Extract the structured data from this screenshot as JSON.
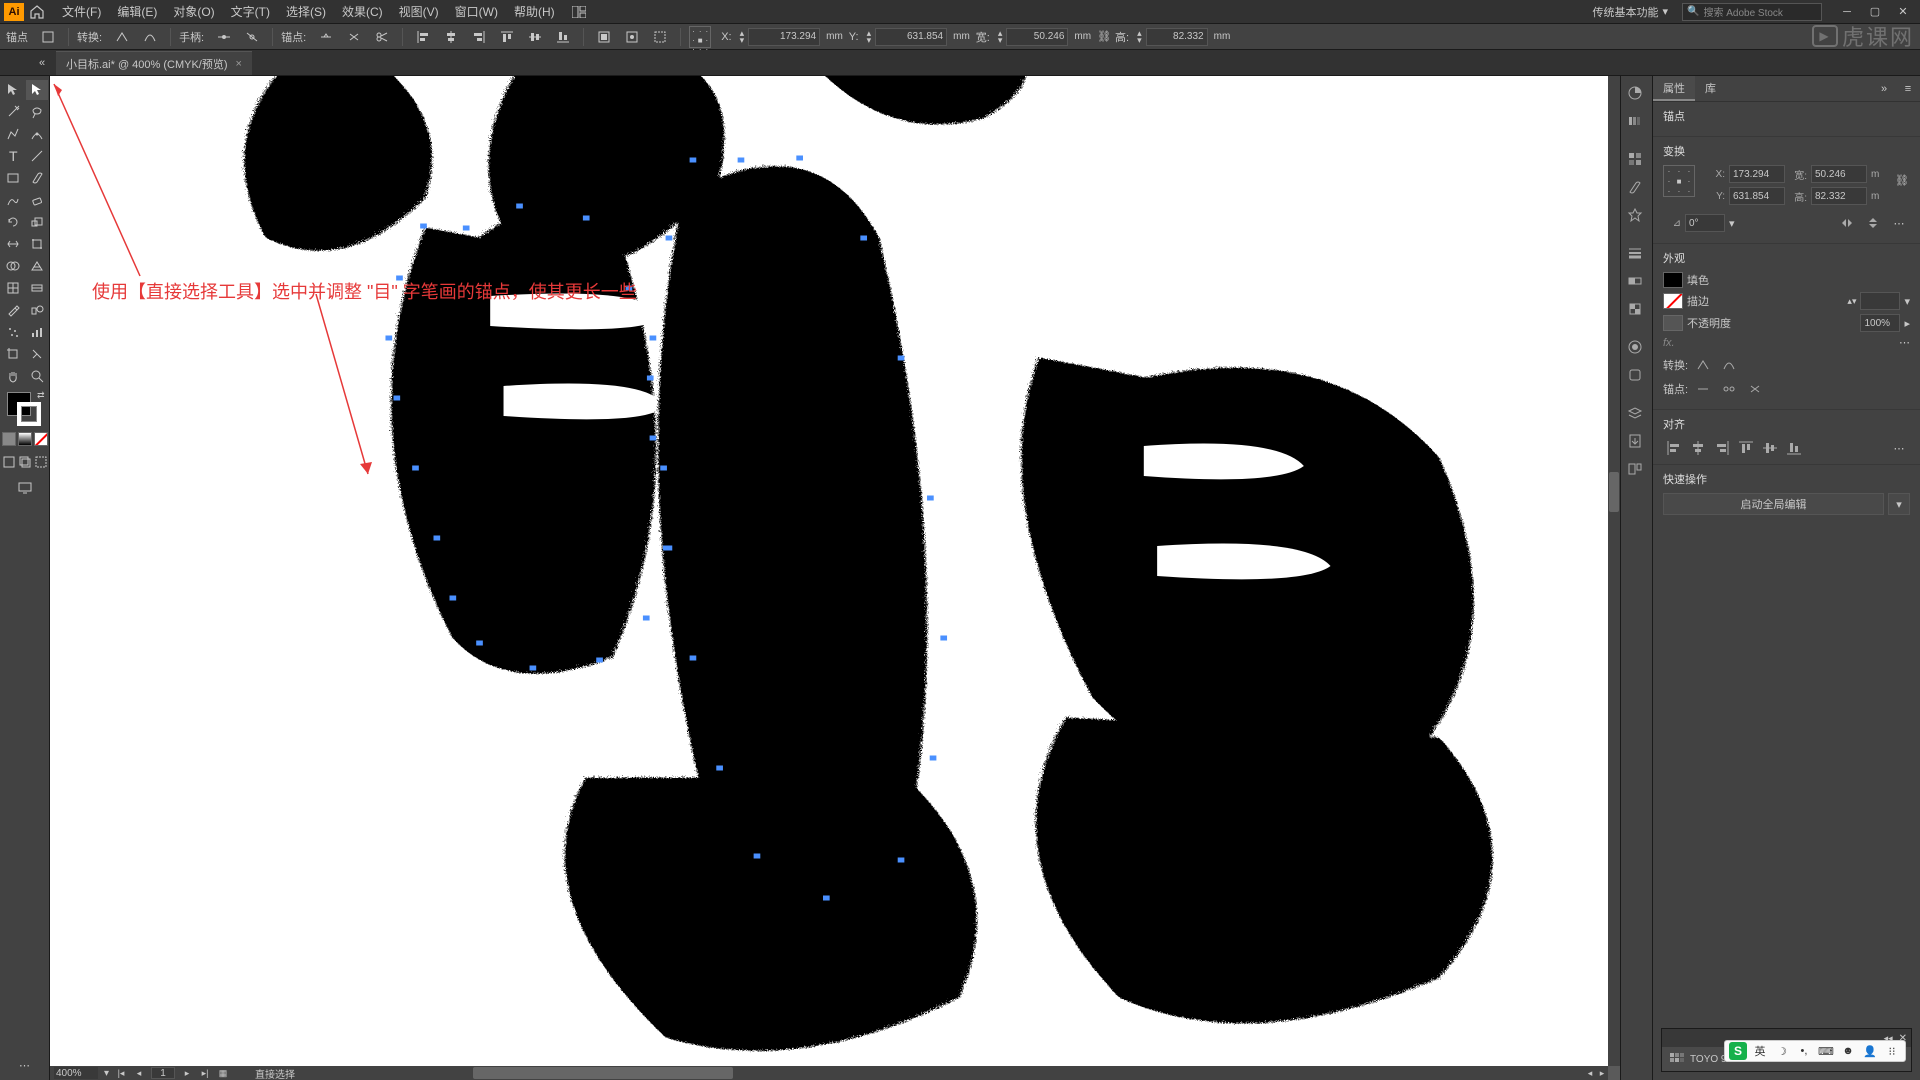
{
  "app": {
    "logo": "Ai"
  },
  "menu": {
    "file": "文件(F)",
    "edit": "编辑(E)",
    "object": "对象(O)",
    "type": "文字(T)",
    "select": "选择(S)",
    "effect": "效果(C)",
    "view": "视图(V)",
    "window": "窗口(W)",
    "help": "帮助(H)"
  },
  "workspace": {
    "label": "传统基本功能",
    "search_placeholder": "搜索 Adobe Stock"
  },
  "control": {
    "anchor_label": "锚点",
    "convert_label": "转换:",
    "handles_label": "手柄:",
    "anchors_label": "锚点:",
    "x_label": "X:",
    "x_val": "173.294",
    "x_unit": "mm",
    "y_label": "Y:",
    "y_val": "631.854",
    "y_unit": "mm",
    "w_label": "宽:",
    "w_val": "50.246",
    "w_unit": "mm",
    "h_label": "高:",
    "h_val": "82.332",
    "h_unit": "mm"
  },
  "tab": {
    "title": "小目标.ai* @ 400% (CMYK/预览)"
  },
  "annotation": {
    "text": "使用【直接选择工具】选中并调整 \"目\" 字笔画的锚点，使其更长一些"
  },
  "status": {
    "zoom": "400%",
    "artboard": "1",
    "tool": "直接选择"
  },
  "props": {
    "tab_properties": "属性",
    "tab_library": "库",
    "selection_label": "锚点",
    "transform_title": "变换",
    "x": "173.294",
    "y": "631.854",
    "w": "50.246",
    "h": "82.332",
    "unit": "m",
    "angle": "0°",
    "appearance_title": "外观",
    "fill_label": "填色",
    "stroke_label": "描边",
    "opacity_label": "不透明度",
    "opacity_value": "100%",
    "convert_title": "转换:",
    "anchor_title": "锚点:",
    "align_title": "对齐",
    "quick_title": "快速操作",
    "quick_button": "启动全局编辑"
  },
  "float_panel": {
    "title": "TOYO 94 COLOR FINDER"
  },
  "watermark": {
    "text": "虎课网"
  },
  "ime": {
    "lang": "英"
  }
}
